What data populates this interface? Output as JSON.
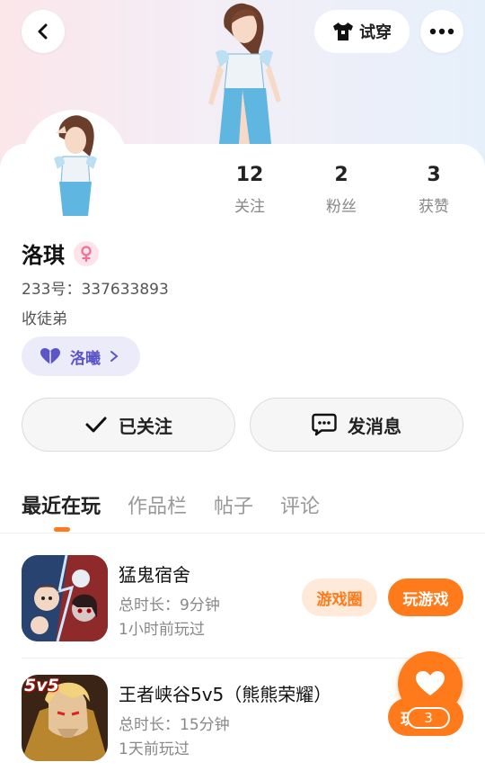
{
  "header": {
    "try_on_label": "试穿"
  },
  "profile": {
    "name": "洛琪",
    "uid_label": "233号：",
    "uid_value": "337633893",
    "signature": "收徒弟",
    "tag_label": "洛曦"
  },
  "stats": [
    {
      "value": "12",
      "label": "关注"
    },
    {
      "value": "2",
      "label": "粉丝"
    },
    {
      "value": "3",
      "label": "获赞"
    }
  ],
  "actions": {
    "follow_label": "已关注",
    "message_label": "发消息"
  },
  "tabs": [
    {
      "label": "最近在玩",
      "active": true
    },
    {
      "label": "作品栏",
      "active": false
    },
    {
      "label": "帖子",
      "active": false
    },
    {
      "label": "评论",
      "active": false
    }
  ],
  "games": [
    {
      "title": "猛鬼宿舍",
      "duration": "总时长：9分钟",
      "last_played": "1小时前玩过",
      "circle_label": "游戏圈",
      "play_label": "玩游戏"
    },
    {
      "title": "王者峡谷5v5（熊熊荣耀）",
      "duration": "总时长：15分钟",
      "last_played": "1天前玩过",
      "icon_text": "5v5",
      "play_label": "玩"
    }
  ],
  "fab": {
    "count": "3"
  },
  "colors": {
    "accent": "#ff7a1a",
    "tag_bg": "#ecebfa",
    "tag_text": "#5b55c9"
  }
}
